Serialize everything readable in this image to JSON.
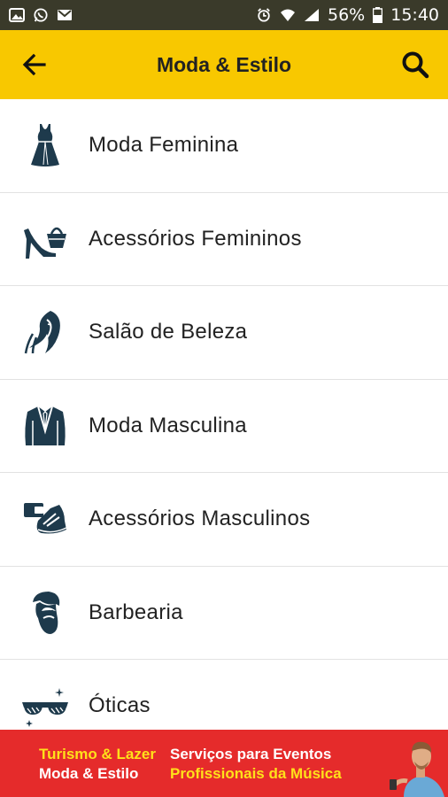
{
  "status_bar": {
    "battery_percent": "56%",
    "time": "15:40"
  },
  "app_bar": {
    "title": "Moda & Estilo"
  },
  "categories": [
    {
      "label": "Moda Feminina",
      "icon": "dress-icon"
    },
    {
      "label": "Acessórios Femininos",
      "icon": "heel-and-bag-icon"
    },
    {
      "label": "Salão de Beleza",
      "icon": "woman-hair-icon"
    },
    {
      "label": "Moda Masculina",
      "icon": "suit-jacket-icon"
    },
    {
      "label": "Acessórios Masculinos",
      "icon": "wallet-and-sneaker-icon"
    },
    {
      "label": "Barbearia",
      "icon": "bearded-man-icon"
    },
    {
      "label": "Óticas",
      "icon": "sunglasses-icon"
    }
  ],
  "banner": {
    "left_top": "Turismo & Lazer",
    "right_top": "Serviços para Eventos",
    "left_bottom": "Moda & Estilo",
    "right_bottom": "Profissionais da Música"
  },
  "colors": {
    "app_bar": "#f8c800",
    "icon": "#1e3a4c",
    "banner": "#e52b2b",
    "banner_yellow": "#ffe11a"
  }
}
